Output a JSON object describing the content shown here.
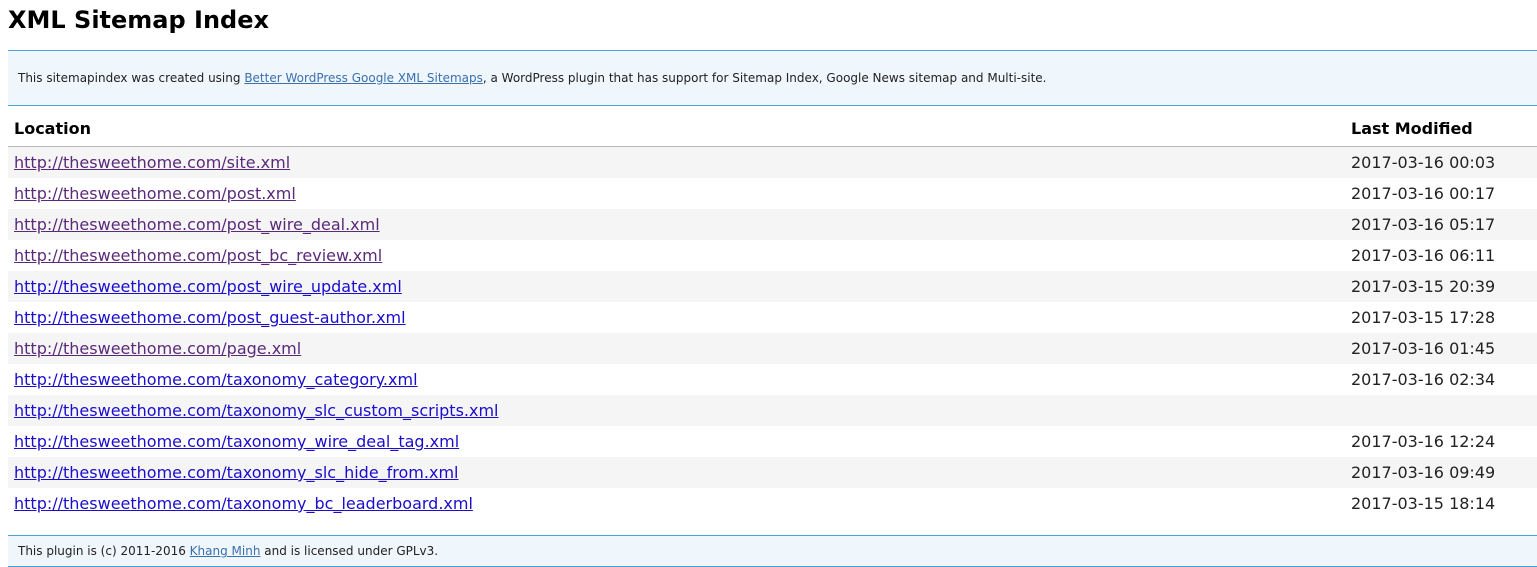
{
  "page": {
    "title": "XML Sitemap Index"
  },
  "intro": {
    "before_link": "This sitemapindex was created using ",
    "link_text": "Better WordPress Google XML Sitemaps",
    "after_link": ", a WordPress plugin that has support for Sitemap Index, Google News sitemap and Multi-site."
  },
  "table": {
    "columns": {
      "location": "Location",
      "last_modified": "Last Modified"
    },
    "rows": [
      {
        "url": "http://thesweethome.com/site.xml",
        "modified": "2017-03-16 00:03",
        "visited": true
      },
      {
        "url": "http://thesweethome.com/post.xml",
        "modified": "2017-03-16 00:17",
        "visited": true
      },
      {
        "url": "http://thesweethome.com/post_wire_deal.xml",
        "modified": "2017-03-16 05:17",
        "visited": true
      },
      {
        "url": "http://thesweethome.com/post_bc_review.xml",
        "modified": "2017-03-16 06:11",
        "visited": true
      },
      {
        "url": "http://thesweethome.com/post_wire_update.xml",
        "modified": "2017-03-15 20:39",
        "visited": false
      },
      {
        "url": "http://thesweethome.com/post_guest-author.xml",
        "modified": "2017-03-15 17:28",
        "visited": false
      },
      {
        "url": "http://thesweethome.com/page.xml",
        "modified": "2017-03-16 01:45",
        "visited": true
      },
      {
        "url": "http://thesweethome.com/taxonomy_category.xml",
        "modified": "2017-03-16 02:34",
        "visited": false
      },
      {
        "url": "http://thesweethome.com/taxonomy_slc_custom_scripts.xml",
        "modified": "",
        "visited": false
      },
      {
        "url": "http://thesweethome.com/taxonomy_wire_deal_tag.xml",
        "modified": "2017-03-16 12:24",
        "visited": false
      },
      {
        "url": "http://thesweethome.com/taxonomy_slc_hide_from.xml",
        "modified": "2017-03-16 09:49",
        "visited": false
      },
      {
        "url": "http://thesweethome.com/taxonomy_bc_leaderboard.xml",
        "modified": "2017-03-15 18:14",
        "visited": false
      }
    ]
  },
  "footer": {
    "before_link": "This plugin is (c) 2011-2016 ",
    "link_text": "Khang Minh",
    "after_link": " and is licensed under GPLv3."
  },
  "colors": {
    "panel_bg": "#eff6fc",
    "panel_border": "#4aa2dc",
    "link": "#1a0dcc",
    "link_visited": "#5a2a7a",
    "row_alt": "#f5f5f5"
  }
}
